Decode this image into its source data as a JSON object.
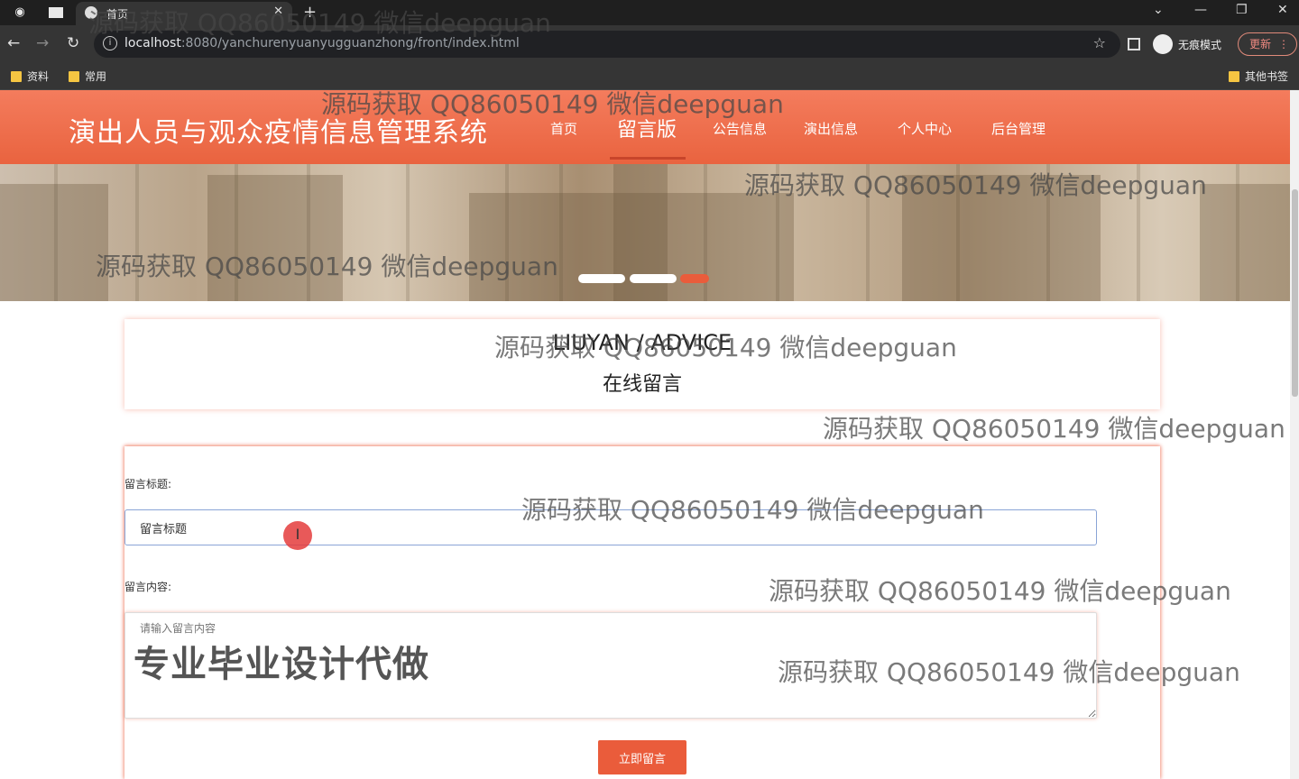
{
  "browser": {
    "tab_title": "首页",
    "url_host": "localhost",
    "url_rest": ":8080/yanchurenyuanyugguanzhong/front/index.html",
    "incognito_label": "无痕模式",
    "update_label": "更新",
    "bookmarks": [
      "资料",
      "常用"
    ],
    "other_bookmarks": "其他书签"
  },
  "site": {
    "title": "演出人员与观众疫情信息管理系统",
    "menu": [
      "首页",
      "留言版",
      "公告信息",
      "演出信息",
      "个人中心",
      "后台管理"
    ],
    "active_menu": "留言版"
  },
  "banner": {
    "slides": 3,
    "active_slide": 3
  },
  "advice": {
    "heading_en": "LIUYAN / ADVICE",
    "heading_cn": "在线留言"
  },
  "form": {
    "title_label": "留言标题:",
    "title_value": "留言标题",
    "content_label": "留言内容:",
    "content_placeholder": "请输入留言内容",
    "submit_label": "立即留言"
  },
  "overlay_text": "专业毕业设计代做",
  "watermark_text": "源码获取 QQ86050149 微信deepguan"
}
